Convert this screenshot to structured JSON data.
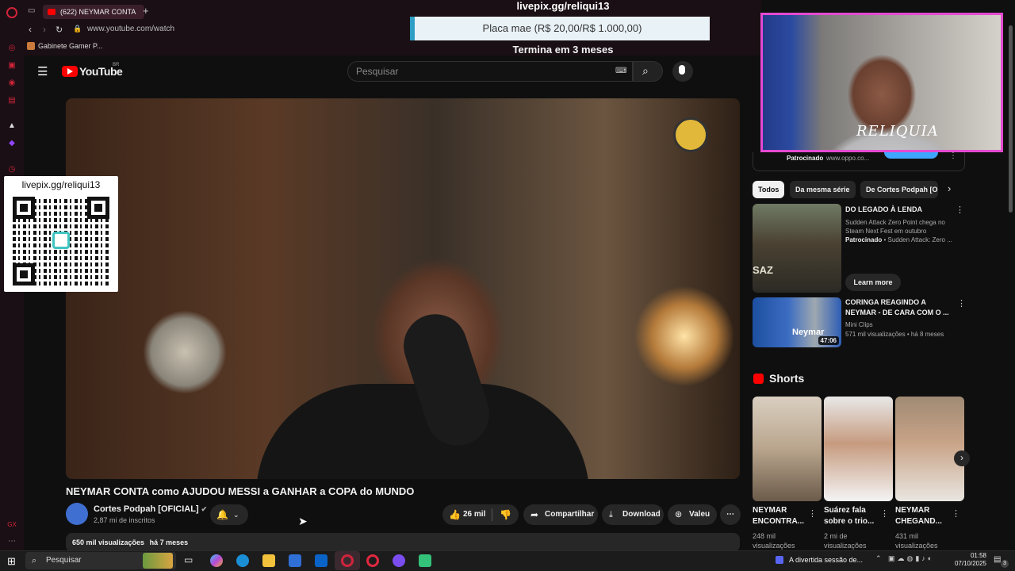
{
  "browser": {
    "tab_title": "(622) NEYMAR CONTA",
    "url": "www.youtube.com/watch",
    "bookmark": "Gabinete Gamer P..."
  },
  "stream_overlay": {
    "pix_url": "livepix.gg/reliqui13",
    "goal_label": "Placa mae (R$ 20,00/R$ 1.000,00)",
    "goal_progress": 0.02,
    "goal_end": "Termina em 3 meses",
    "qr_label": "livepix.gg/reliqui13",
    "cam_label": "RELIQUIA"
  },
  "youtube": {
    "logo": "YouTube",
    "country": "BR",
    "search_placeholder": "Pesquisar",
    "video_title": "NEYMAR CONTA como AJUDOU MESSI a GANHAR a COPA do MUNDO",
    "channel_name": "Cortes Podpah [OFICIAL]",
    "channel_subs": "2,87 mi de inscritos",
    "likes": "26 mil",
    "share_label": "Compartilhar",
    "download_label": "Download",
    "thanks_label": "Valeu",
    "views": "650 mil visualizações",
    "age": "há 7 meses"
  },
  "sidebar": {
    "ad_sponsor": "Patrocinado",
    "ad_url": "www.oppo.co...",
    "chips": [
      "Todos",
      "Da mesma série",
      "De Cortes Podpah [O"
    ],
    "items": [
      {
        "title": "DO LEGADO À LENDA",
        "line2": "Sudden Attack Zero Point chega no",
        "line3": "Steam Next Fest em outubro",
        "sponsor": "Patrocinado",
        "sponsor_rest": " • Sudden Attack: Zero ...",
        "cta": "Learn more",
        "thumb_text": "SAZ"
      },
      {
        "title_line1": "CORINGA REAGINDO A",
        "title_line2": "NEYMAR - DE CARA COM O ...",
        "channel": "Mini Clips",
        "stats": "571 mil visualizações • há 8 meses",
        "duration": "47:06",
        "thumb_text": "Neymar"
      }
    ],
    "shorts_title": "Shorts",
    "shorts": [
      {
        "title_line1": "NEYMAR",
        "title_line2": "ENCONTRA...",
        "views_line1": "248 mil",
        "views_line2": "visualizações"
      },
      {
        "title_line1": "Suárez fala",
        "title_line2": "sobre o trio...",
        "views_line1": "2 mi de",
        "views_line2": "visualizações"
      },
      {
        "title_line1": "NEYMAR",
        "title_line2": "CHEGAND...",
        "views_line1": "431 mil",
        "views_line2": "visualizações"
      }
    ]
  },
  "taskbar": {
    "search_label": "Pesquisar",
    "notification": "A divertida sessão de...",
    "time": "01:58",
    "date": "07/10/2025",
    "badge": "3"
  },
  "colors": {
    "yt_red": "#ff0000",
    "opera_red": "#d0243b",
    "cam_border": "#e54ad1",
    "goal_accent": "#2f9ec5"
  }
}
